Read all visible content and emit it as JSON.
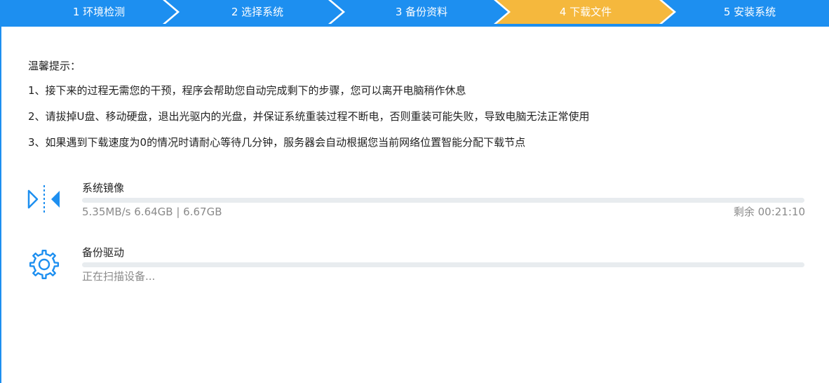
{
  "steps": [
    {
      "label": "1 环境检测",
      "state": "done"
    },
    {
      "label": "2 选择系统",
      "state": "done"
    },
    {
      "label": "3 备份资料",
      "state": "done"
    },
    {
      "label": "4 下载文件",
      "state": "active"
    },
    {
      "label": "5 安装系统",
      "state": "pending"
    }
  ],
  "colors": {
    "step_blue": "#1d8ff0",
    "step_active": "#f5b83d",
    "accent": "#1d8ff0"
  },
  "tips": {
    "title": "温馨提示：",
    "lines": [
      "1、接下来的过程无需您的干预，程序会帮助您自动完成剩下的步骤，您可以离开电脑稍作休息",
      "2、请拔掉U盘、移动硬盘，退出光驱内的光盘，并保证系统重装过程不断电，否则重装可能失败，导致电脑无法正常使用",
      "3、如果遇到下载速度为0的情况时请耐心等待几分钟，服务器会自动根据您当前网络位置智能分配下载节点"
    ]
  },
  "tasks": [
    {
      "name": "系统镜像",
      "icon": "download-arrows-icon",
      "status": "5.35MB/s 6.64GB | 6.67GB",
      "remaining": "剩余 00:21:10",
      "progress": 0
    },
    {
      "name": "备份驱动",
      "icon": "gear-icon",
      "status": "正在扫描设备...",
      "progress": 0
    }
  ]
}
